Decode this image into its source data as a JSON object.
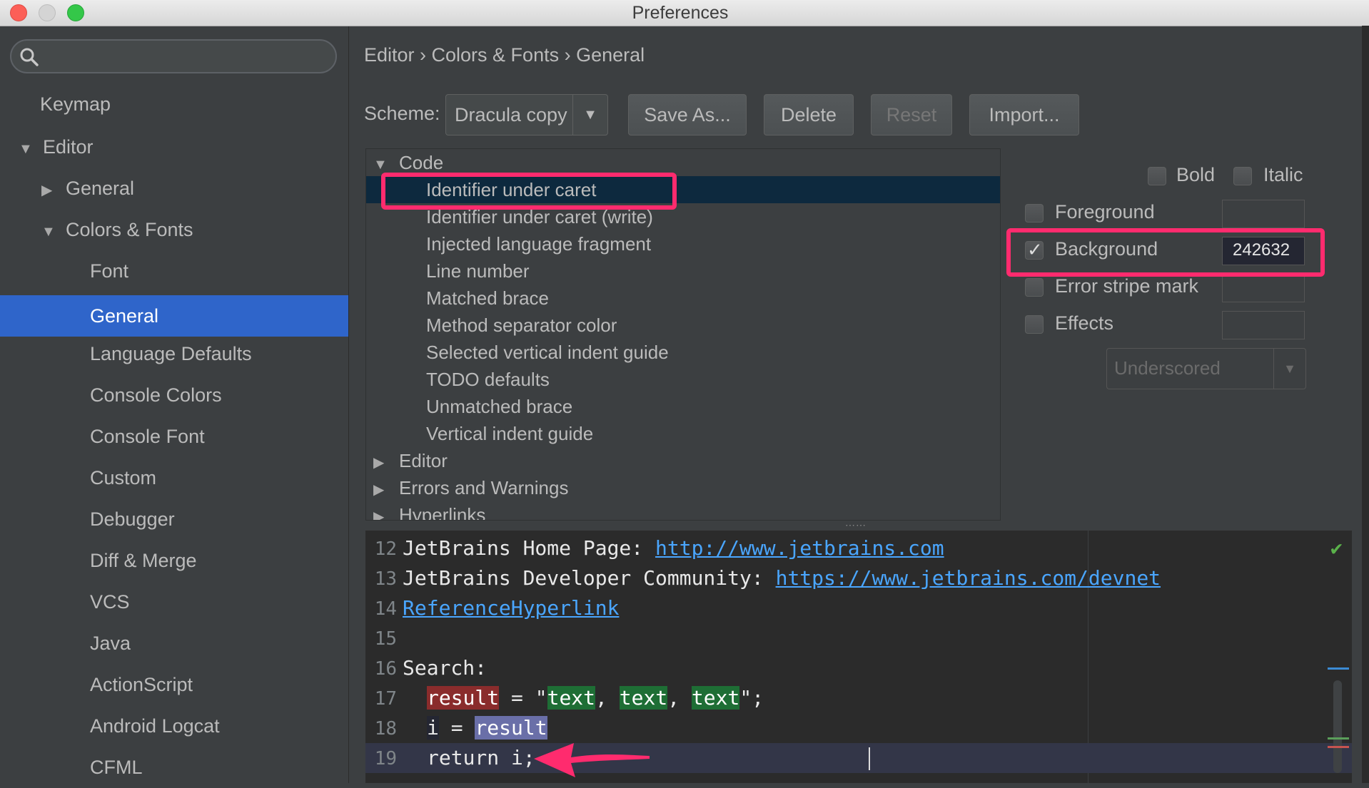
{
  "window": {
    "title": "Preferences"
  },
  "sidebar": {
    "search_placeholder": "",
    "items": [
      {
        "label": "Keymap"
      },
      {
        "label": "Editor"
      },
      {
        "label": "General"
      },
      {
        "label": "Colors & Fonts"
      },
      {
        "label": "Font"
      },
      {
        "label": "General"
      },
      {
        "label": "Language Defaults"
      },
      {
        "label": "Console Colors"
      },
      {
        "label": "Console Font"
      },
      {
        "label": "Custom"
      },
      {
        "label": "Debugger"
      },
      {
        "label": "Diff & Merge"
      },
      {
        "label": "VCS"
      },
      {
        "label": "Java"
      },
      {
        "label": "ActionScript"
      },
      {
        "label": "Android Logcat"
      },
      {
        "label": "CFML"
      }
    ]
  },
  "main": {
    "breadcrumb": "Editor › Colors & Fonts › General",
    "scheme_label": "Scheme:",
    "scheme_value": "Dracula copy",
    "buttons": {
      "save_as": "Save As...",
      "delete": "Delete",
      "reset": "Reset",
      "import": "Import..."
    },
    "tree": {
      "code_group": "Code",
      "items": [
        "Identifier under caret",
        "Identifier under caret (write)",
        "Injected language fragment",
        "Line number",
        "Matched brace",
        "Method separator color",
        "Selected vertical indent guide",
        "TODO defaults",
        "Unmatched brace",
        "Vertical indent guide"
      ],
      "groups": [
        "Editor",
        "Errors and Warnings",
        "Hyperlinks"
      ]
    },
    "attributes": {
      "bold": "Bold",
      "italic": "Italic",
      "foreground": "Foreground",
      "background": "Background",
      "background_value": "242632",
      "error_stripe": "Error stripe mark",
      "effects": "Effects",
      "effect_type": "Underscored"
    },
    "preview": {
      "line_numbers": [
        "12",
        "13",
        "14",
        "15",
        "16",
        "17",
        "18",
        "19"
      ],
      "l12_text": "JetBrains Home Page: ",
      "l12_link": "http://www.jetbrains.com",
      "l13_text": "JetBrains Developer Community: ",
      "l13_link": "https://www.jetbrains.com/devnet",
      "l14_link": "ReferenceHyperlink",
      "l16_text": "Search:",
      "l17_var": "result",
      "l17_eq": " = \"",
      "l17_t1": "text",
      "l17_t2": "text",
      "l17_t3": "text",
      "l17_end": "\";",
      "l18_i": "i",
      "l18_eq": " = ",
      "l18_var": "result",
      "l19_text": "return i;"
    }
  },
  "colors": {
    "selection_accent": "#2f65ca",
    "annotation": "#ff2b6e",
    "link": "#4aa6ff"
  }
}
